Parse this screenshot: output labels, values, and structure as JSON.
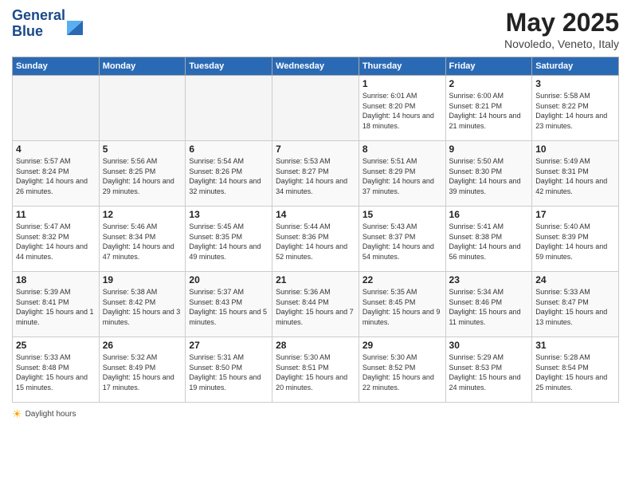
{
  "header": {
    "logo_line1": "General",
    "logo_line2": "Blue",
    "month": "May 2025",
    "location": "Novoledo, Veneto, Italy"
  },
  "days_of_week": [
    "Sunday",
    "Monday",
    "Tuesday",
    "Wednesday",
    "Thursday",
    "Friday",
    "Saturday"
  ],
  "weeks": [
    [
      {
        "day": "",
        "empty": true
      },
      {
        "day": "",
        "empty": true
      },
      {
        "day": "",
        "empty": true
      },
      {
        "day": "",
        "empty": true
      },
      {
        "day": "1",
        "sunrise": "6:01 AM",
        "sunset": "8:20 PM",
        "daylight": "14 hours and 18 minutes."
      },
      {
        "day": "2",
        "sunrise": "6:00 AM",
        "sunset": "8:21 PM",
        "daylight": "14 hours and 21 minutes."
      },
      {
        "day": "3",
        "sunrise": "5:58 AM",
        "sunset": "8:22 PM",
        "daylight": "14 hours and 23 minutes."
      }
    ],
    [
      {
        "day": "4",
        "sunrise": "5:57 AM",
        "sunset": "8:24 PM",
        "daylight": "14 hours and 26 minutes."
      },
      {
        "day": "5",
        "sunrise": "5:56 AM",
        "sunset": "8:25 PM",
        "daylight": "14 hours and 29 minutes."
      },
      {
        "day": "6",
        "sunrise": "5:54 AM",
        "sunset": "8:26 PM",
        "daylight": "14 hours and 32 minutes."
      },
      {
        "day": "7",
        "sunrise": "5:53 AM",
        "sunset": "8:27 PM",
        "daylight": "14 hours and 34 minutes."
      },
      {
        "day": "8",
        "sunrise": "5:51 AM",
        "sunset": "8:29 PM",
        "daylight": "14 hours and 37 minutes."
      },
      {
        "day": "9",
        "sunrise": "5:50 AM",
        "sunset": "8:30 PM",
        "daylight": "14 hours and 39 minutes."
      },
      {
        "day": "10",
        "sunrise": "5:49 AM",
        "sunset": "8:31 PM",
        "daylight": "14 hours and 42 minutes."
      }
    ],
    [
      {
        "day": "11",
        "sunrise": "5:47 AM",
        "sunset": "8:32 PM",
        "daylight": "14 hours and 44 minutes."
      },
      {
        "day": "12",
        "sunrise": "5:46 AM",
        "sunset": "8:34 PM",
        "daylight": "14 hours and 47 minutes."
      },
      {
        "day": "13",
        "sunrise": "5:45 AM",
        "sunset": "8:35 PM",
        "daylight": "14 hours and 49 minutes."
      },
      {
        "day": "14",
        "sunrise": "5:44 AM",
        "sunset": "8:36 PM",
        "daylight": "14 hours and 52 minutes."
      },
      {
        "day": "15",
        "sunrise": "5:43 AM",
        "sunset": "8:37 PM",
        "daylight": "14 hours and 54 minutes."
      },
      {
        "day": "16",
        "sunrise": "5:41 AM",
        "sunset": "8:38 PM",
        "daylight": "14 hours and 56 minutes."
      },
      {
        "day": "17",
        "sunrise": "5:40 AM",
        "sunset": "8:39 PM",
        "daylight": "14 hours and 59 minutes."
      }
    ],
    [
      {
        "day": "18",
        "sunrise": "5:39 AM",
        "sunset": "8:41 PM",
        "daylight": "15 hours and 1 minute."
      },
      {
        "day": "19",
        "sunrise": "5:38 AM",
        "sunset": "8:42 PM",
        "daylight": "15 hours and 3 minutes."
      },
      {
        "day": "20",
        "sunrise": "5:37 AM",
        "sunset": "8:43 PM",
        "daylight": "15 hours and 5 minutes."
      },
      {
        "day": "21",
        "sunrise": "5:36 AM",
        "sunset": "8:44 PM",
        "daylight": "15 hours and 7 minutes."
      },
      {
        "day": "22",
        "sunrise": "5:35 AM",
        "sunset": "8:45 PM",
        "daylight": "15 hours and 9 minutes."
      },
      {
        "day": "23",
        "sunrise": "5:34 AM",
        "sunset": "8:46 PM",
        "daylight": "15 hours and 11 minutes."
      },
      {
        "day": "24",
        "sunrise": "5:33 AM",
        "sunset": "8:47 PM",
        "daylight": "15 hours and 13 minutes."
      }
    ],
    [
      {
        "day": "25",
        "sunrise": "5:33 AM",
        "sunset": "8:48 PM",
        "daylight": "15 hours and 15 minutes."
      },
      {
        "day": "26",
        "sunrise": "5:32 AM",
        "sunset": "8:49 PM",
        "daylight": "15 hours and 17 minutes."
      },
      {
        "day": "27",
        "sunrise": "5:31 AM",
        "sunset": "8:50 PM",
        "daylight": "15 hours and 19 minutes."
      },
      {
        "day": "28",
        "sunrise": "5:30 AM",
        "sunset": "8:51 PM",
        "daylight": "15 hours and 20 minutes."
      },
      {
        "day": "29",
        "sunrise": "5:30 AM",
        "sunset": "8:52 PM",
        "daylight": "15 hours and 22 minutes."
      },
      {
        "day": "30",
        "sunrise": "5:29 AM",
        "sunset": "8:53 PM",
        "daylight": "15 hours and 24 minutes."
      },
      {
        "day": "31",
        "sunrise": "5:28 AM",
        "sunset": "8:54 PM",
        "daylight": "15 hours and 25 minutes."
      }
    ]
  ],
  "footer": {
    "daylight_label": "Daylight hours"
  }
}
